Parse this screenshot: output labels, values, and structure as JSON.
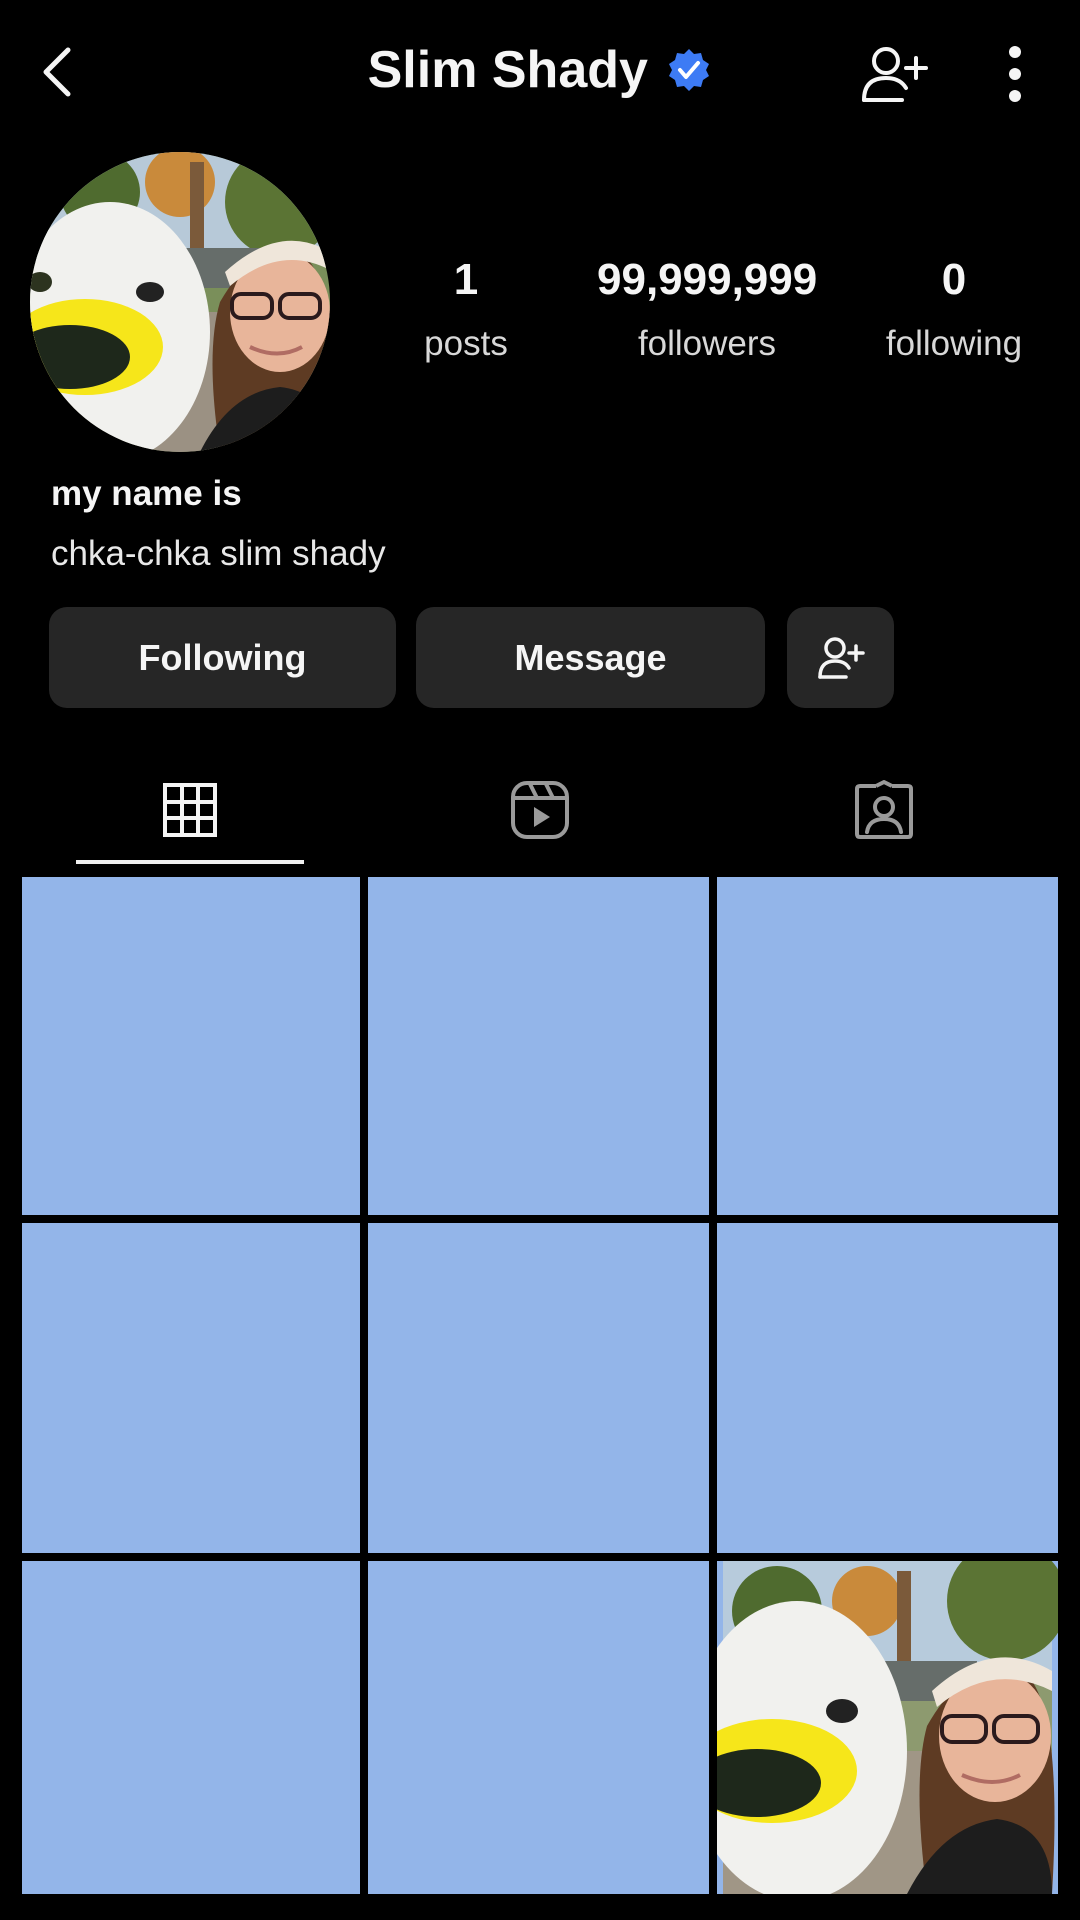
{
  "header": {
    "title": "Slim Shady",
    "verified": true,
    "icons": {
      "back": "chevron-left-icon",
      "add_user": "person-add-icon",
      "more": "vertical-dots-icon",
      "verified": "verified-badge-icon"
    }
  },
  "profile": {
    "avatar": "profile-photo-mascot-selfie",
    "stats": [
      {
        "value": "1",
        "label": "posts"
      },
      {
        "value": "99,999,999",
        "label": "followers"
      },
      {
        "value": "0",
        "label": "following"
      }
    ],
    "name": "my name is",
    "bio": "chka-chka slim shady"
  },
  "actions": {
    "following_label": "Following",
    "message_label": "Message",
    "suggest_icon": "person-add-icon"
  },
  "tabs": [
    {
      "name": "posts-grid",
      "icon": "grid-icon",
      "selected": true
    },
    {
      "name": "reels",
      "icon": "reels-icon",
      "selected": false
    },
    {
      "name": "tagged",
      "icon": "tagged-person-icon",
      "selected": false
    }
  ],
  "grid": {
    "tile_color": "#93b5e9",
    "tiles": 9,
    "photo_tile_index": 8
  },
  "colors": {
    "background": "#000000",
    "button_bg": "#262626",
    "verified_blue": "#3d7bf5",
    "tile_blue": "#93b5e9"
  }
}
